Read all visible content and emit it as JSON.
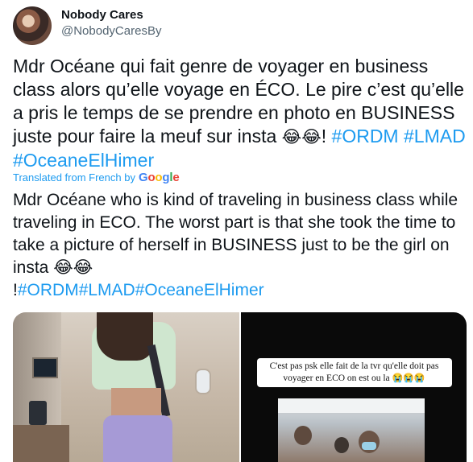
{
  "tweet": {
    "display_name": "Nobody Cares",
    "handle": "@NobodyCaresBy",
    "text_main": "Mdr Océane qui fait genre de voyager en business class alors qu’elle voyage en ÉCO. Le pire c’est qu’elle a pris le temps de se prendre en photo en BUSINESS juste pour faire la meuf sur insta ",
    "text_emojis": "😂😂",
    "text_bang": "! ",
    "hashtags": [
      "#ORDM",
      "#LMAD",
      "#OceaneElHimer"
    ],
    "translated_label": "Translated from French by",
    "translated_brand": "Google",
    "translation_main": "Mdr Océane who is kind of traveling in business class while traveling in ECO. The worst part is that she took the time to take a picture of herself in BUSINESS just to be the girl on insta ",
    "translation_emojis": "😂😂",
    "translation_bang": "!",
    "translation_hashtags": [
      "#ORDM",
      "#LMAD",
      "#OceaneElHimer"
    ]
  },
  "media": {
    "right_caption": "C'est pas psk elle fait de la tvr qu'elle doit pas voyager en ECO on est ou la ",
    "right_caption_emojis": "😭😭😭"
  },
  "colors": {
    "link": "#1d9bf0",
    "text": "#0f1419",
    "secondary": "#536471"
  }
}
